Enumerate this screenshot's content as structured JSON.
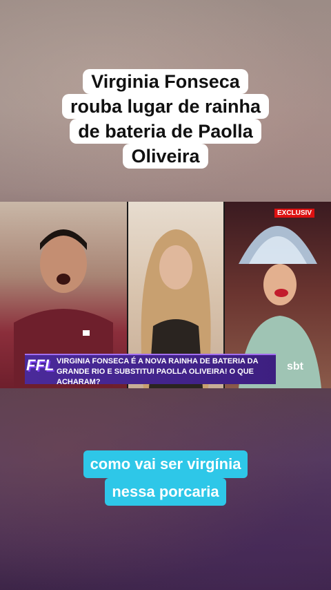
{
  "headline": {
    "lines": [
      "Virginia Fonseca",
      "rouba lugar de rainha",
      "de bateria de Paolla",
      "Oliveira"
    ]
  },
  "video": {
    "exclusive_badge": "EXCLUSIV",
    "ticker_text": "VIRGINIA FONSECA É A NOVA RAINHA DE BATERIA DA GRANDE RIO E SUBSTITUI PAOLLA OLIVEIRA! O QUE ACHARAM?",
    "show_logo": "FFL",
    "channel_logo": "sbt"
  },
  "caption": {
    "lines": [
      "como vai ser virgínia",
      "nessa porcaria"
    ]
  },
  "colors": {
    "caption_bg": "#2ec7e8",
    "headline_bg": "#ffffff",
    "ticker_bg": "#4a2a9a"
  }
}
